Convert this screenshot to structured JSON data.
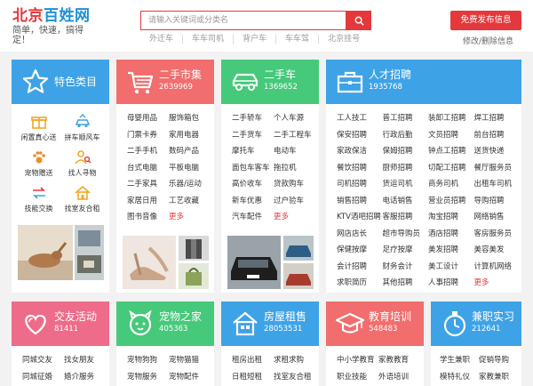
{
  "header": {
    "logo_city": "北京",
    "logo_name": "百姓网",
    "slogan": "简单，快速，搞得定！",
    "search_placeholder": "请输入关键词或分类名",
    "hot_links": [
      "外迁车",
      "车车司机",
      "背户车",
      "车车驾",
      "北京挂号"
    ],
    "post_button": "免费发布信息",
    "edit_link": "修改/删除信息"
  },
  "featured": {
    "title": "特色类目",
    "items": [
      {
        "label": "闲置真心送",
        "icon": "gift-icon"
      },
      {
        "label": "拼车顺风车",
        "icon": "car-share-icon"
      },
      {
        "label": "宠物赠送",
        "icon": "paw-icon"
      },
      {
        "label": "找人寻物",
        "icon": "search-person-icon"
      },
      {
        "label": "技能交换",
        "icon": "exchange-icon"
      },
      {
        "label": "找室友合租",
        "icon": "home-icon"
      }
    ]
  },
  "secondhand": {
    "title": "二手市集",
    "count": "2639969",
    "items": [
      "母婴用品",
      "服饰箱包",
      "门票卡券",
      "家用电器",
      "二手手机",
      "数码产品",
      "台式电脑",
      "平板电脑",
      "二手家具",
      "乐器/运动",
      "家居日用",
      "工艺收藏",
      "图书音像",
      "更多"
    ]
  },
  "usedcar": {
    "title": "二手车",
    "count": "1369652",
    "items": [
      "二手轿车",
      "个人车源",
      "二手货车",
      "二手工程车",
      "摩托车",
      "电动车",
      "面包车客车",
      "拖拉机",
      "高价收车",
      "贷款购车",
      "新车优惠",
      "过户验车",
      "汽车配件",
      "更多"
    ]
  },
  "jobs": {
    "title": "人才招聘",
    "count": "1935768",
    "items": [
      "工人技工",
      "普工招聘",
      "装卸工招聘",
      "焊工招聘",
      "保安招聘",
      "行政后勤",
      "文员招聘",
      "前台招聘",
      "家政保洁",
      "保姆招聘",
      "钟点工招聘",
      "送货快递",
      "餐饮招聘",
      "厨师招聘",
      "切配工招聘",
      "餐厅服务员",
      "司机招聘",
      "货运司机",
      "商务司机",
      "出租车司机",
      "销售招聘",
      "电话销售",
      "营业员招聘",
      "导购招聘",
      "KTV酒吧招聘",
      "客服招聘",
      "淘宝招聘",
      "网络销售",
      "网店店长",
      "超市导购员",
      "酒店招聘",
      "客房服务员",
      "保健按摩",
      "足疗按摩",
      "美发招聘",
      "美容美发",
      "会计招聘",
      "财务会计",
      "美工设计",
      "计算机网络",
      "求职简历",
      "其他招聘",
      "人事招聘",
      "更多"
    ]
  },
  "social": {
    "title": "交友活动",
    "count": "81411",
    "items": [
      "同城交友",
      "找女朋友",
      "同城征婚",
      "婚介服务"
    ]
  },
  "pets": {
    "title": "宠物之家",
    "count": "405363",
    "items": [
      "宠物狗狗",
      "宠物猫猫",
      "宠物服务",
      "宠物配件"
    ]
  },
  "housing": {
    "title": "房屋租售",
    "count": "28053531",
    "items": [
      "租房出租",
      "求租求购",
      "日租短租",
      "找室友合租"
    ]
  },
  "education": {
    "title": "教育培训",
    "count": "548483",
    "items": [
      "中小学教育",
      "家教教育",
      "职业技能",
      "外语培训"
    ]
  },
  "parttime": {
    "title": "兼职实习",
    "count": "212641",
    "items": [
      "学生兼职",
      "促销导购",
      "模特礼仪",
      "家教兼职"
    ]
  },
  "colors": {
    "orange": "#f5a623",
    "red_tile": "#f26d6d",
    "green": "#46c97a",
    "blue": "#3ea3e6",
    "pink": "#ef6b8a",
    "accent": "#e4393c"
  }
}
